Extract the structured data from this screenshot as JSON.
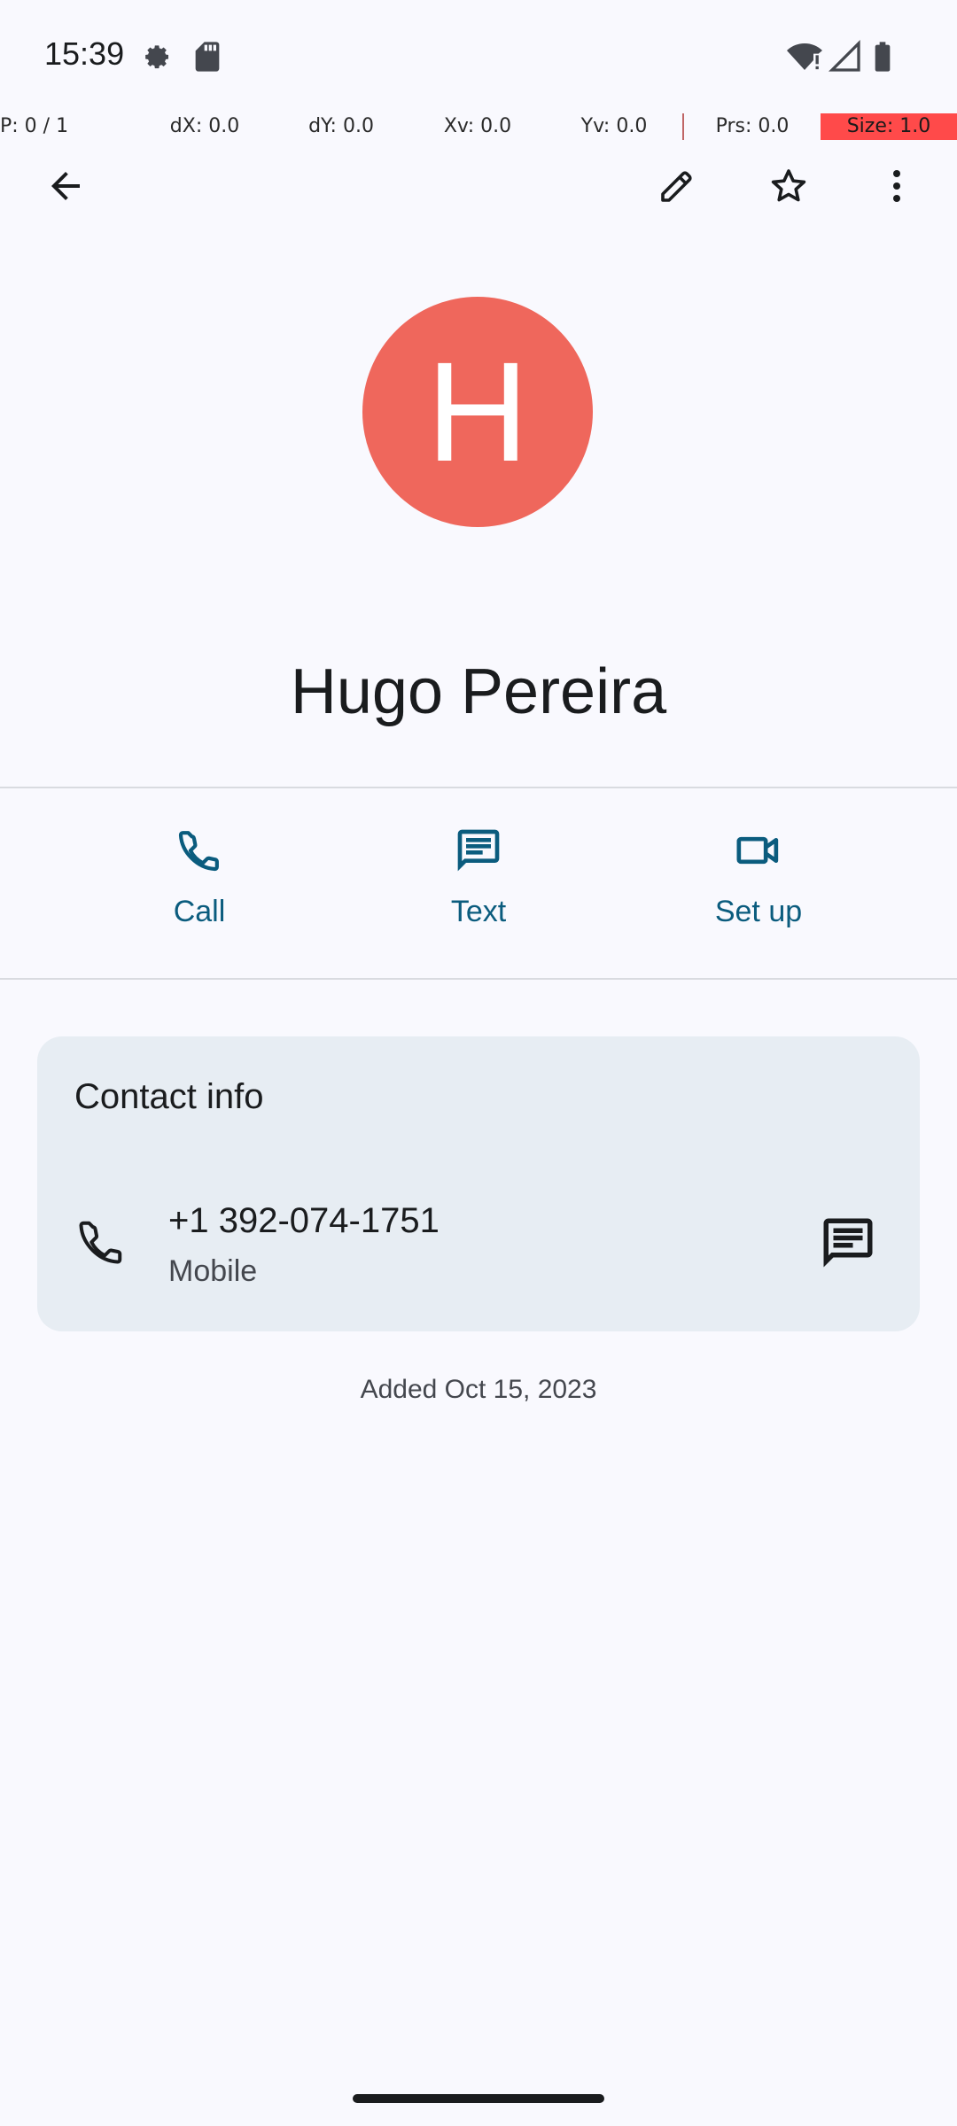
{
  "status_bar": {
    "time": "15:39",
    "icons": [
      "settings-icon",
      "sd-card-icon",
      "wifi-alert-icon",
      "signal-icon",
      "battery-icon"
    ]
  },
  "pointer_debug": {
    "p": "P: 0 / 1",
    "dx": "dX: 0.0",
    "dy": "dY: 0.0",
    "xv": "Xv: 0.0",
    "yv": "Yv: 0.0",
    "prs": "Prs: 0.0",
    "size": "Size: 1.0"
  },
  "top_bar": {
    "icons": [
      "back-arrow-icon",
      "edit-pencil-icon",
      "star-outline-icon",
      "more-vert-icon"
    ]
  },
  "contact": {
    "initial": "H",
    "name": "Hugo Pereira",
    "avatar_color": "#ef675c"
  },
  "actions": [
    {
      "label": "Call",
      "icon": "phone-icon"
    },
    {
      "label": "Text",
      "icon": "message-icon"
    },
    {
      "label": "Set up",
      "icon": "video-icon"
    }
  ],
  "contact_info": {
    "title": "Contact info",
    "phone_number": "+1 392-074-1751",
    "phone_type": "Mobile"
  },
  "added": "Added Oct 15, 2023",
  "colors": {
    "accent": "#0b5c7e",
    "background": "#f9f9fe",
    "card": "#e7edf3"
  }
}
